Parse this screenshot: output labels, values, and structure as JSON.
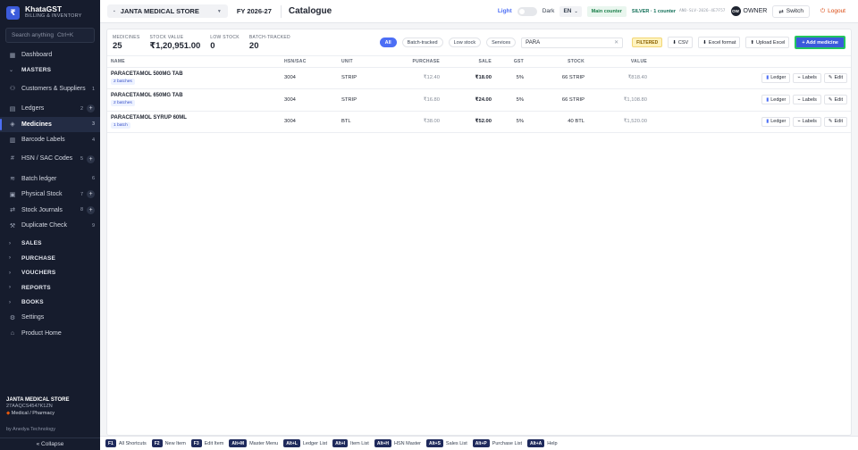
{
  "brand": {
    "logo": "₹",
    "name": "KhataGST",
    "tagline": "BILLING & INVENTORY"
  },
  "sidebar": {
    "search_placeholder": "Search anything",
    "search_shortcut": "Ctrl+K",
    "dashboard": {
      "label": "Dashboard",
      "icon": "grid-icon"
    },
    "masters_label": "MASTERS",
    "masters": [
      {
        "label": "Customers & Suppliers",
        "count": "1",
        "plus": false,
        "icon": "users-icon"
      },
      {
        "label": "Ledgers",
        "count": "2",
        "plus": true,
        "icon": "book-icon"
      },
      {
        "label": "Medicines",
        "count": "3",
        "plus": false,
        "active": true,
        "icon": "tag-icon"
      },
      {
        "label": "Barcode Labels",
        "count": "4",
        "plus": false,
        "icon": "barcode-icon"
      },
      {
        "label": "HSN / SAC Codes",
        "count": "5",
        "plus": true,
        "icon": "hash-icon"
      },
      {
        "label": "Batch ledger",
        "count": "6",
        "plus": false,
        "icon": "layers-icon"
      },
      {
        "label": "Physical Stock",
        "count": "7",
        "plus": true,
        "icon": "box-icon"
      },
      {
        "label": "Stock Journals",
        "count": "8",
        "plus": true,
        "icon": "swap-icon"
      },
      {
        "label": "Duplicate Check",
        "count": "9",
        "plus": false,
        "icon": "wrench-icon"
      }
    ],
    "groups": [
      "SALES",
      "PURCHASE",
      "VOUCHERS",
      "REPORTS",
      "BOOKS"
    ],
    "settings": "Settings",
    "product_home": "Product Home",
    "footer": {
      "store": "JANTA MEDICAL STORE",
      "gstin": "27AAQCS4547K1ZN",
      "category": "Medical / Pharmacy",
      "by": "by Anedya Technology",
      "collapse": "« Collapse"
    }
  },
  "topbar": {
    "store": "JANTA MEDICAL STORE",
    "fy": "FY 2026-27",
    "title": "Catalogue",
    "theme_light": "Light",
    "theme_dark": "Dark",
    "lang": "EN",
    "counter": "Main counter",
    "license_tier": "SILVER · 1 counter",
    "license_code": "ANO-SLV-2026-4E7F57",
    "owner_initials": "OW",
    "owner": "OWNER",
    "switch": "Switch",
    "logout": "Logout"
  },
  "summary": [
    {
      "label": "MEDICINES",
      "value": "25"
    },
    {
      "label": "STOCK VALUE",
      "value": "₹1,20,951.00"
    },
    {
      "label": "LOW STOCK",
      "value": "0"
    },
    {
      "label": "BATCH-TRACKED",
      "value": "20"
    }
  ],
  "filters": {
    "chips": [
      "All",
      "Batch-tracked",
      "Low stock",
      "Services"
    ],
    "search_value": "PARA",
    "filtered_badge": "FILTERED",
    "csv": "CSV",
    "excel_format": "Excel format",
    "upload_excel": "Upload Excel",
    "add": "+ Add medicine"
  },
  "table": {
    "columns": [
      "NAME",
      "HSN/SAC",
      "UNIT",
      "PURCHASE",
      "SALE",
      "GST",
      "STOCK",
      "VALUE"
    ],
    "rows": [
      {
        "name": "PARACETAMOL 500MG TAB",
        "batches": "2 batches",
        "hsn": "3004",
        "unit": "STRIP",
        "purchase": "₹12.40",
        "sale": "₹18.00",
        "gst": "5%",
        "stock": "66 STRIP",
        "value": "₹818.40"
      },
      {
        "name": "PARACETAMOL 650MG TAB",
        "batches": "2 batches",
        "hsn": "3004",
        "unit": "STRIP",
        "purchase": "₹16.80",
        "sale": "₹24.00",
        "gst": "5%",
        "stock": "66 STRIP",
        "value": "₹1,108.80"
      },
      {
        "name": "PARACETAMOL SYRUP 60ML",
        "batches": "1 batch",
        "hsn": "3004",
        "unit": "BTL",
        "purchase": "₹38.00",
        "sale": "₹52.00",
        "gst": "5%",
        "stock": "40 BTL",
        "value": "₹1,520.00"
      }
    ],
    "actions": {
      "ledger": "Ledger",
      "labels": "Labels",
      "edit": "Edit"
    }
  },
  "shortcuts": [
    {
      "key": "F1",
      "label": "All Shortcuts"
    },
    {
      "key": "F2",
      "label": "New Item"
    },
    {
      "key": "F3",
      "label": "Edit Item"
    },
    {
      "key": "Alt+M",
      "label": "Master Menu"
    },
    {
      "key": "Alt+L",
      "label": "Ledger List"
    },
    {
      "key": "Alt+I",
      "label": "Item List"
    },
    {
      "key": "Alt+H",
      "label": "HSN Master"
    },
    {
      "key": "Alt+S",
      "label": "Sales List"
    },
    {
      "key": "Alt+P",
      "label": "Purchase List"
    },
    {
      "key": "Alt+A",
      "label": "Help"
    }
  ],
  "colors": {
    "sidebar_bg": "#161c2d",
    "accent": "#3b5bdb",
    "add_outline": "#23c55e"
  }
}
